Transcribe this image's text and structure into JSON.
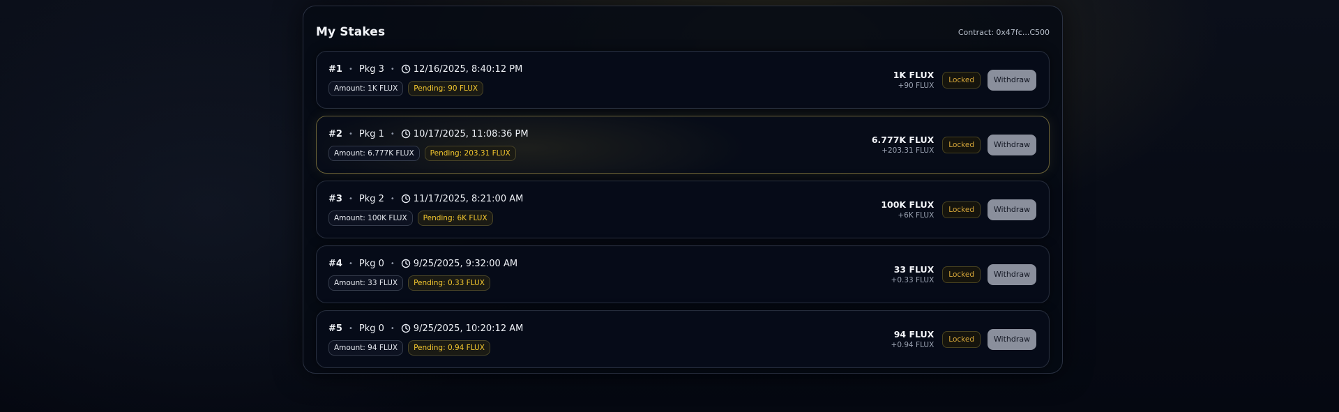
{
  "panel": {
    "title": "My Stakes",
    "contract": "Contract: 0x47fc...C500"
  },
  "stakes": [
    {
      "id": "#1",
      "pkg": "Pkg 3",
      "date": "12/16/2025, 8:40:12 PM",
      "amount_badge": "Amount: 1K FLUX",
      "pending_badge": "Pending: 90 FLUX",
      "total": "1K FLUX",
      "reward": "+90 FLUX",
      "status": "Locked",
      "action": "Withdraw"
    },
    {
      "id": "#2",
      "pkg": "Pkg 1",
      "date": "10/17/2025, 11:08:36 PM",
      "amount_badge": "Amount: 6.777K FLUX",
      "pending_badge": "Pending: 203.31 FLUX",
      "total": "6.777K FLUX",
      "reward": "+203.31 FLUX",
      "status": "Locked",
      "action": "Withdraw"
    },
    {
      "id": "#3",
      "pkg": "Pkg 2",
      "date": "11/17/2025, 8:21:00 AM",
      "amount_badge": "Amount: 100K FLUX",
      "pending_badge": "Pending: 6K FLUX",
      "total": "100K FLUX",
      "reward": "+6K FLUX",
      "status": "Locked",
      "action": "Withdraw"
    },
    {
      "id": "#4",
      "pkg": "Pkg 0",
      "date": "9/25/2025, 9:32:00 AM",
      "amount_badge": "Amount: 33 FLUX",
      "pending_badge": "Pending: 0.33 FLUX",
      "total": "33 FLUX",
      "reward": "+0.33 FLUX",
      "status": "Locked",
      "action": "Withdraw"
    },
    {
      "id": "#5",
      "pkg": "Pkg 0",
      "date": "9/25/2025, 10:20:12 AM",
      "amount_badge": "Amount: 94 FLUX",
      "pending_badge": "Pending: 0.94 FLUX",
      "total": "94 FLUX",
      "reward": "+0.94 FLUX",
      "status": "Locked",
      "action": "Withdraw"
    }
  ],
  "colors": {
    "accent_gold": "#f2c62e",
    "locked_text": "#d8a83a",
    "withdraw_bg": "#8a8f9c",
    "highlight_border": "#6d6438"
  },
  "icons": {
    "time": "clock-icon"
  }
}
